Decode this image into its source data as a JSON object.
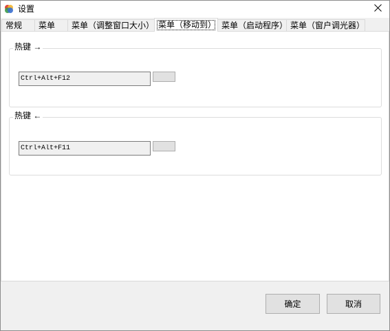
{
  "title_bar": {
    "title": "设置",
    "app_icon": "app-icon",
    "close_icon": "close-icon"
  },
  "tabs": [
    {
      "label": "常规",
      "selected": false
    },
    {
      "label": "菜单",
      "selected": false
    },
    {
      "label": "菜单（调整窗口大小）",
      "selected": false
    },
    {
      "label": "菜单（移动到）",
      "selected": true
    },
    {
      "label": "菜单（启动程序）",
      "selected": false
    },
    {
      "label": "菜单（窗户调光器）",
      "selected": false
    }
  ],
  "hotkey_groups": [
    {
      "label": "热键 →",
      "hotkey": "Ctrl+Alt+F12"
    },
    {
      "label": "热键 ←",
      "hotkey": "Ctrl+Alt+F11"
    }
  ],
  "footer": {
    "ok_label": "确定",
    "cancel_label": "取消"
  },
  "colors": {
    "dialog_background": "#f0f0f0",
    "panel_background": "#ffffff",
    "button_face": "#e1e1e1",
    "readonly_field_background": "#f0f0f0"
  }
}
